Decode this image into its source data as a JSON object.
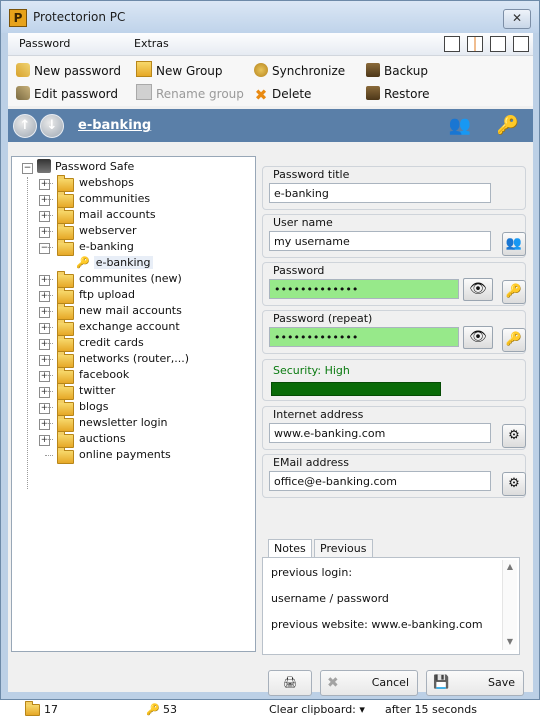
{
  "window": {
    "title": "Protectorion PC",
    "icon_letter": "P",
    "close_glyph": "✕"
  },
  "menu": {
    "items": [
      "Password",
      "Extras"
    ]
  },
  "toolbar": {
    "new_password": "New password",
    "edit_password": "Edit password",
    "new_group": "New Group",
    "rename_group": "Rename group",
    "synchronize": "Synchronize",
    "delete": "Delete",
    "backup": "Backup",
    "restore": "Restore"
  },
  "navbar": {
    "title": "e-banking",
    "up_glyph": "↑",
    "down_glyph": "↓"
  },
  "tree": {
    "root": "Password Safe",
    "groups": [
      "webshops",
      "communities",
      "mail accounts",
      "webserver",
      "e-banking",
      "communites (new)",
      "ftp upload",
      "new mail accounts",
      "exchange account",
      "credit cards",
      "networks (router,...)",
      "facebook",
      "twitter",
      "blogs",
      "newsletter login",
      "auctions",
      "online payments"
    ],
    "child": "e-banking"
  },
  "details": {
    "password_title": {
      "label": "Password title",
      "value": "e-banking"
    },
    "user_name": {
      "label": "User name",
      "value": "my username"
    },
    "password": {
      "label": "Password",
      "value": "•••••••••••••"
    },
    "password_repeat": {
      "label": "Password (repeat)",
      "value": "•••••••••••••"
    },
    "security": {
      "label": "Security: High",
      "level": 1.0
    },
    "internet_address": {
      "label": "Internet address",
      "value": "www.e-banking.com"
    },
    "email_address": {
      "label": "EMail address",
      "value": "office@e-banking.com"
    },
    "notes_tabs": [
      "Notes",
      "Previous"
    ],
    "notes_text": "previous login:\n\nusername / password\n\nprevious website: www.e-banking.com"
  },
  "buttons": {
    "cancel": "Cancel",
    "save": "Save"
  },
  "status": {
    "folder_count": "17",
    "key_count": "53",
    "clear_clipboard": "Clear clipboard:",
    "dropdown_glyph": "▾",
    "after": "after 15 seconds"
  }
}
